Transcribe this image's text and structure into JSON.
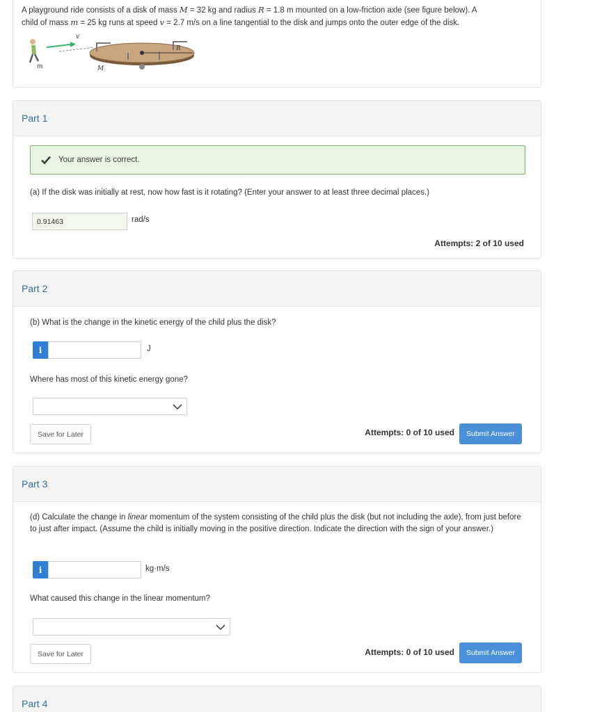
{
  "problem": {
    "line1_a": "A playground ride consists of a disk of mass ",
    "var_M": "M",
    "eq1": " = 32 kg and radius ",
    "var_R": "R",
    "eq2": " = 1.8 m mounted on a low-friction axle (see figure below). A",
    "line2_a": "child of mass ",
    "var_m": "m",
    "eq3": " = 25 kg runs at speed ",
    "var_v": "v",
    "eq4": " = 2.7 m/s on a line tangential to the disk and jumps onto the outer edge of the disk.",
    "figure_labels": {
      "v": "v",
      "m": "m",
      "M": "M",
      "R": "R"
    }
  },
  "part1": {
    "title": "Part 1",
    "success": "Your answer is correct.",
    "question": "(a) If the disk was initially at rest, now how fast is it rotating? (Enter your answer to at least three decimal places.)",
    "answer": "0.91463",
    "unit": "rad/s",
    "attempts": "Attempts: 2 of 10 used"
  },
  "part2": {
    "title": "Part 2",
    "question_b": "(b) What is the change in the kinetic energy of the child plus the disk?",
    "info": "i",
    "unit": "J",
    "question_c": "Where has most of this kinetic energy gone?",
    "save_label": "Save for Later",
    "attempts": "Attempts: 0 of 10 used",
    "submit_label": "Submit Answer"
  },
  "part3": {
    "title": "Part 3",
    "question_d_1": "(d) Calculate the change in ",
    "question_d_em": "linear",
    "question_d_2": " momentum of the system consisting of the child plus the disk (but not including the axle), from just before to just after impact. (Assume the child is initially moving in the positive direction. Indicate the direction with the sign of your answer.)",
    "info": "i",
    "unit": "kg·m/s",
    "question_e": "What caused this change in the linear momentum?",
    "save_label": "Save for Later",
    "attempts": "Attempts: 0 of 10 used",
    "submit_label": "Submit Answer"
  },
  "part4": {
    "title": "Part 4"
  },
  "colors": {
    "accent": "#2f6f9f",
    "success_bg": "#eaf4e5",
    "success_border": "#7fb56a",
    "submit": "#4a90d9"
  }
}
